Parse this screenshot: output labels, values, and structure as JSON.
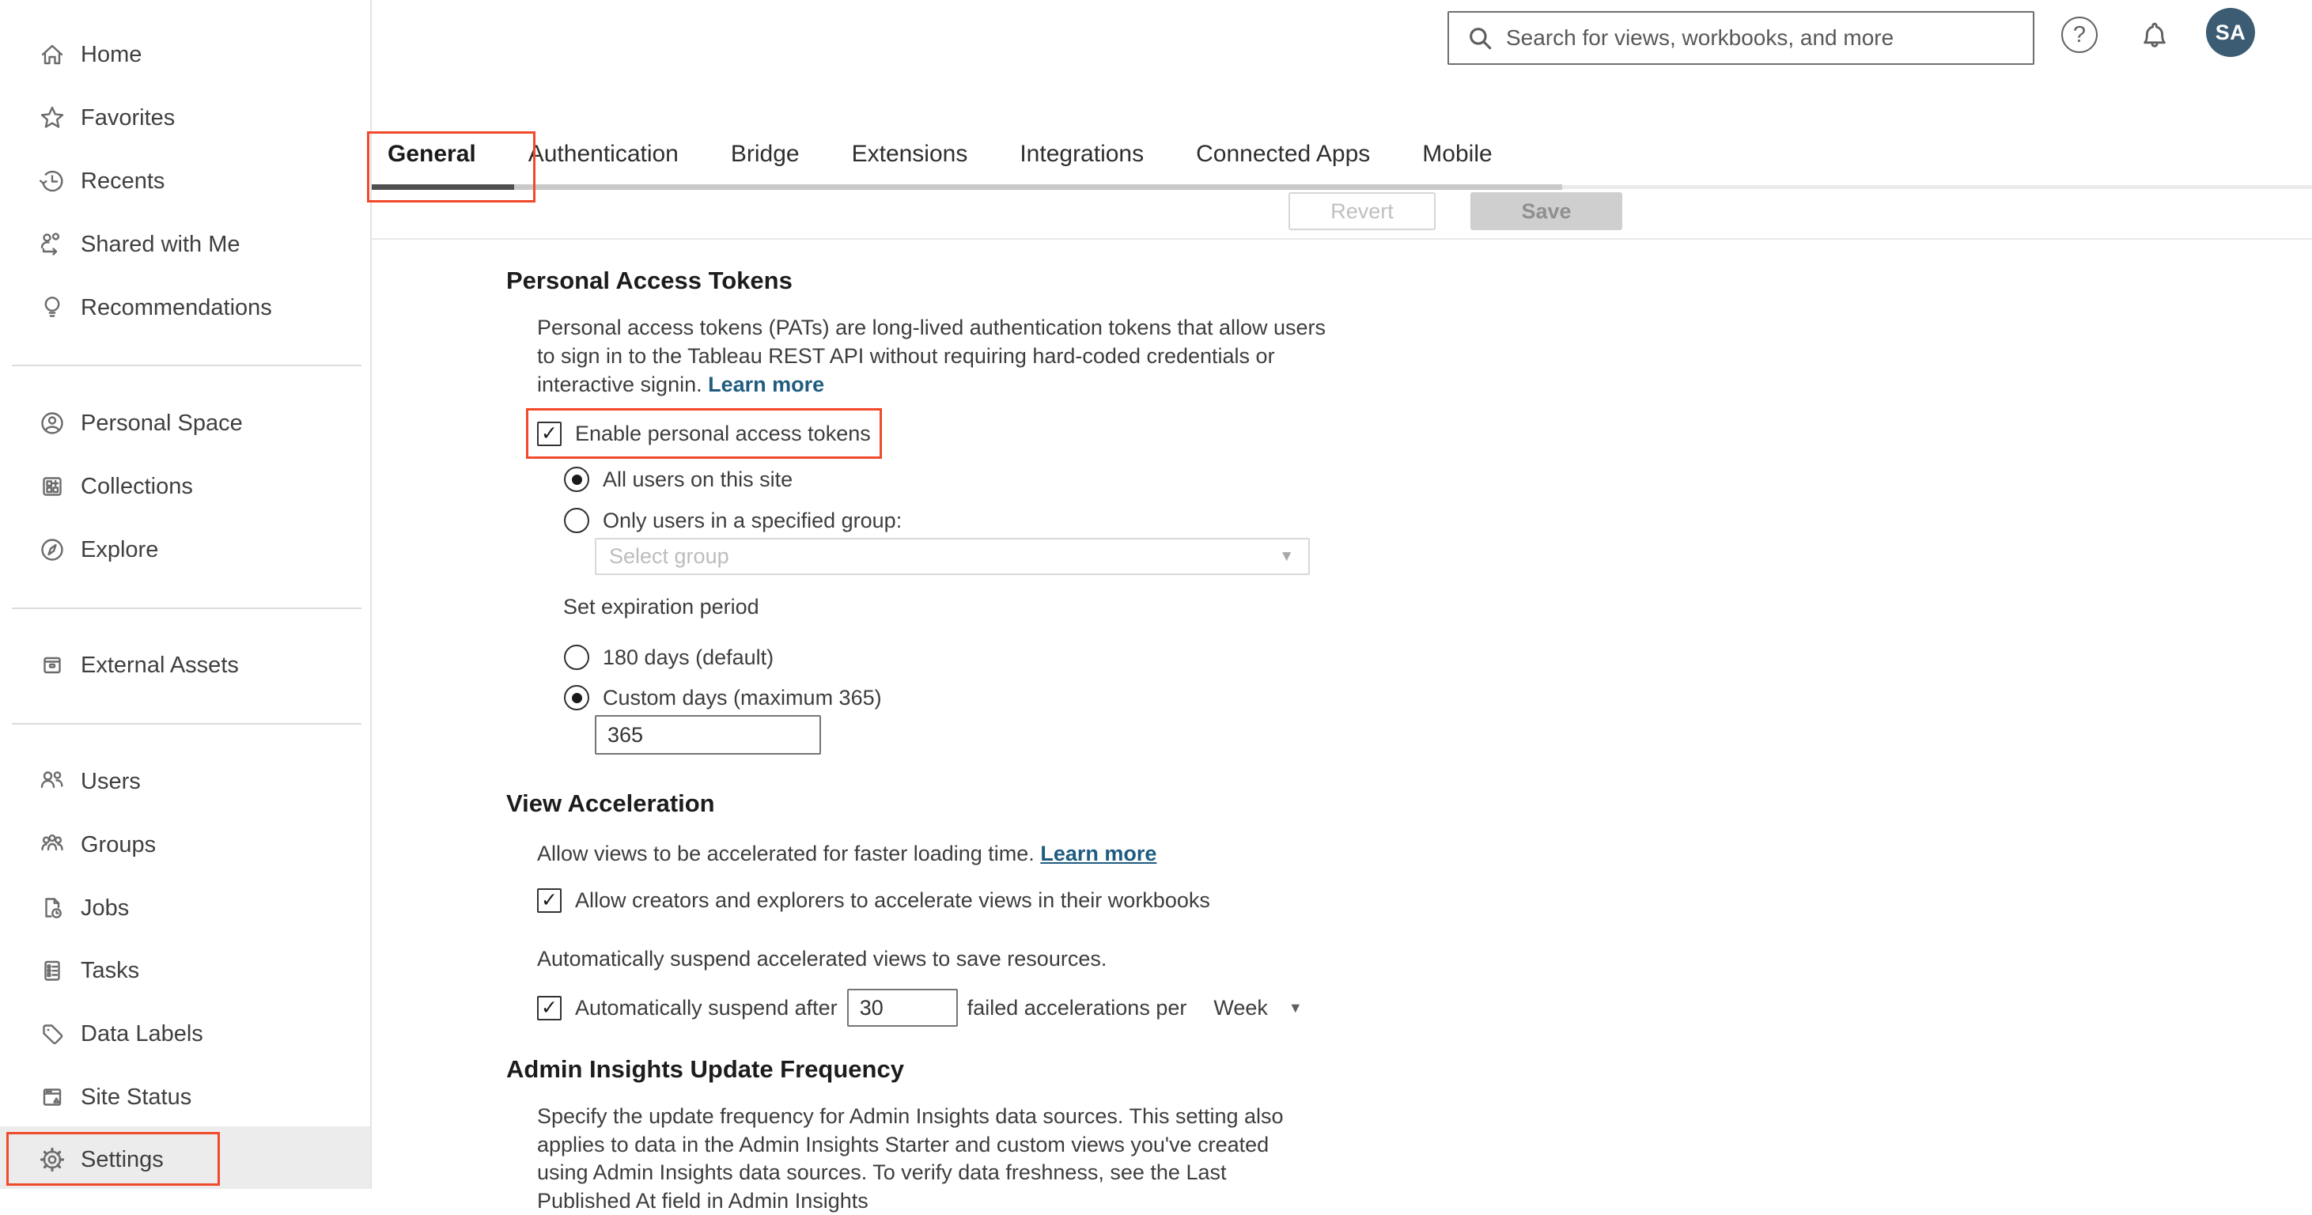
{
  "header": {
    "search_placeholder": "Search for views, workbooks, and more",
    "avatar_initials": "SA",
    "help_glyph": "?"
  },
  "sidebar": {
    "items": [
      {
        "label": "Home"
      },
      {
        "label": "Favorites"
      },
      {
        "label": "Recents"
      },
      {
        "label": "Shared with Me"
      },
      {
        "label": "Recommendations"
      },
      {
        "label": "Personal Space"
      },
      {
        "label": "Collections"
      },
      {
        "label": "Explore"
      },
      {
        "label": "External Assets"
      },
      {
        "label": "Users"
      },
      {
        "label": "Groups"
      },
      {
        "label": "Jobs"
      },
      {
        "label": "Tasks"
      },
      {
        "label": "Data Labels"
      },
      {
        "label": "Site Status"
      },
      {
        "label": "Settings",
        "selected": true
      }
    ]
  },
  "tabs": {
    "items": [
      "General",
      "Authentication",
      "Bridge",
      "Extensions",
      "Integrations",
      "Connected Apps",
      "Mobile"
    ],
    "selected": "General"
  },
  "toolbar": {
    "revert_label": "Revert",
    "save_label": "Save"
  },
  "pat": {
    "title": "Personal Access Tokens",
    "description": "Personal access tokens (PATs) are long-lived authentication tokens that allow users to sign in to the Tableau REST API without requiring hard-coded credentials or interactive signin.",
    "learn_more": "Learn more",
    "enable_label": "Enable personal access tokens",
    "enable_checked": true,
    "scope_all_label": "All users on this site",
    "scope_all_selected": true,
    "scope_group_label": "Only users in a specified group:",
    "scope_group_selected": false,
    "group_placeholder": "Select group",
    "group_caret": "▼",
    "expiration_label": "Set expiration period",
    "expiration_default_label": "180 days (default)",
    "expiration_default_selected": false,
    "expiration_custom_label": "Custom days (maximum 365)",
    "expiration_custom_selected": true,
    "custom_days_value": "365"
  },
  "view_acceleration": {
    "title": "View Acceleration",
    "description": "Allow views to be accelerated for faster loading time.",
    "learn_more": "Learn more",
    "allow_label": "Allow creators and explorers to accelerate views in their workbooks",
    "allow_checked": true,
    "suspend_description": "Automatically suspend accelerated views to save resources.",
    "suspend_prefix": "Automatically suspend after",
    "suspend_value": "30",
    "suspend_suffix": "failed accelerations per",
    "suspend_period": "Week",
    "period_caret": "▼",
    "suspend_checked": true
  },
  "admin_insights": {
    "title": "Admin Insights Update Frequency",
    "description": "Specify the update frequency for Admin Insights data sources. This setting also applies to data in the Admin Insights Starter and custom views you've created using Admin Insights data sources. To verify data freshness, see the Last Published At field in Admin Insights"
  },
  "colors": {
    "annotation_red": "#f1492a",
    "link_blue": "#1f5c80",
    "avatar_bg": "#3c5c74",
    "tab_underline": "#4f4f4f"
  },
  "checkmark_glyph": "✓"
}
